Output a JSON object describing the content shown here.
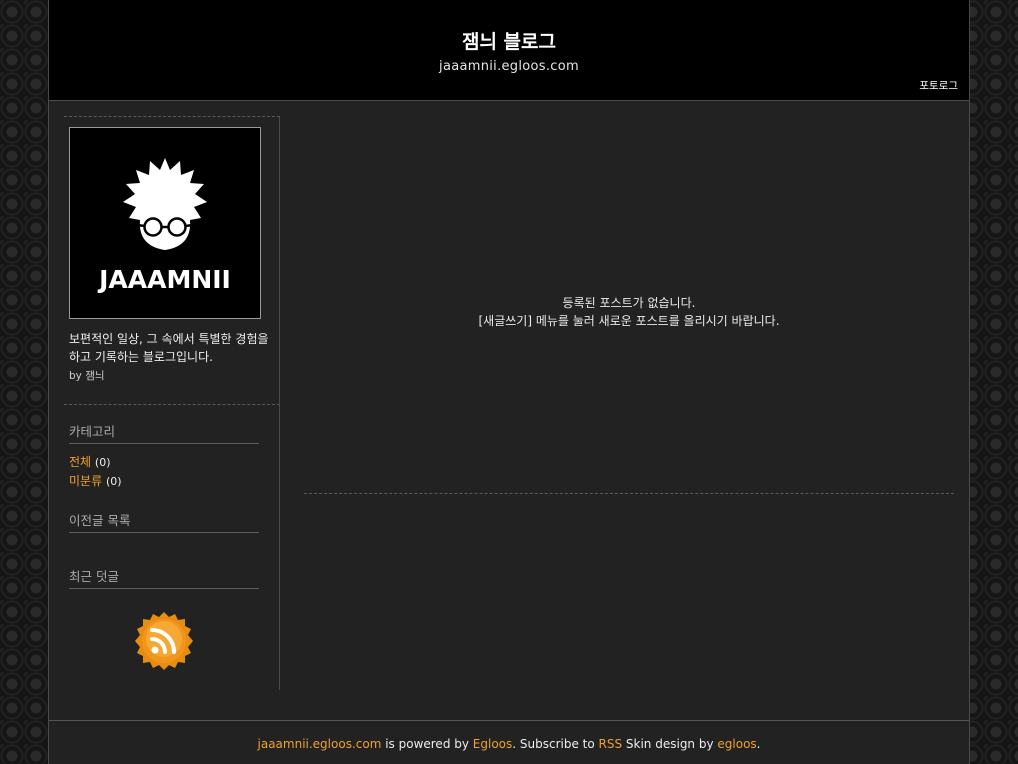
{
  "header": {
    "title": "잼늬 블로그",
    "url": "jaaamnii.egloos.com",
    "photolog_link": "포토로그"
  },
  "sidebar": {
    "profile": {
      "logo_text": "JAAAMNII",
      "description": "보편적인 일상, 그 속에서 특별한 경험을 하고 기록하는 블로그입니다.",
      "by_label": "by",
      "author": "잼늬"
    },
    "categories": {
      "heading": "카테고리",
      "items": [
        {
          "label": "전체",
          "count": "(0)"
        },
        {
          "label": "미분류",
          "count": "(0)"
        }
      ]
    },
    "archive": {
      "heading": "이전글 목록"
    },
    "recent_comments": {
      "heading": "최근 덧글"
    },
    "rss_icon": "rss-icon"
  },
  "main": {
    "empty_line1": "등록된 포스트가 없습니다.",
    "empty_line2": "[새글쓰기] 메뉴를 눌러 새로운 포스트를 올리시기 바랍니다."
  },
  "footer": {
    "site_link": "jaaamnii.egloos.com",
    "powered_text": " is powered by ",
    "egloos_link": "Egloos",
    "subscribe_text": ". Subscribe to ",
    "rss_link": "RSS",
    "skin_text": " Skin design by ",
    "skin_link": "egloos",
    "end_text": "."
  },
  "colors": {
    "accent": "#f0a030",
    "background": "#222222",
    "header_bg": "#000000"
  }
}
